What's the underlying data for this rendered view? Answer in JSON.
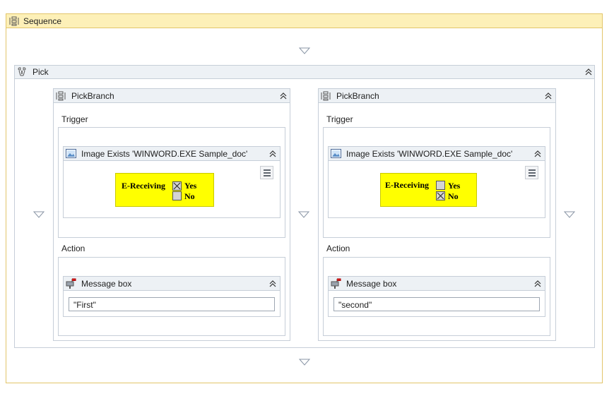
{
  "sequence": {
    "title": "Sequence",
    "icon": "sequence-icon"
  },
  "pick": {
    "title": "Pick",
    "icon": "pick-icon"
  },
  "branches": [
    {
      "title": "PickBranch",
      "trigger_label": "Trigger",
      "action_label": "Action",
      "image_activity": {
        "title": "Image Exists 'WINWORD.EXE Sample_doc'",
        "preview": {
          "label": "E-Receiving",
          "yes": "Yes",
          "no": "No",
          "checked": "Yes"
        }
      },
      "message_activity": {
        "title": "Message box",
        "value": "\"First\""
      }
    },
    {
      "title": "PickBranch",
      "trigger_label": "Trigger",
      "action_label": "Action",
      "image_activity": {
        "title": "Image Exists 'WINWORD.EXE Sample_doc'",
        "preview": {
          "label": "E-Receiving",
          "yes": "Yes",
          "no": "No",
          "checked": "No"
        }
      },
      "message_activity": {
        "title": "Message box",
        "value": "\"second\""
      }
    }
  ],
  "colors": {
    "sequence_border": "#e2c56a",
    "sequence_header": "#fdf0b8",
    "container_border": "#c6ced8",
    "container_header": "#edf1f5",
    "preview_background": "#ffff00"
  }
}
